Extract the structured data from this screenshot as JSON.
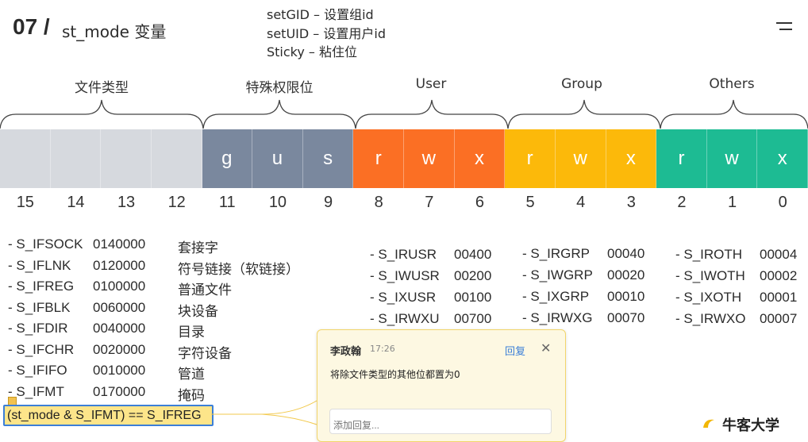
{
  "header": {
    "number": "07 /",
    "title": "st_mode 变量",
    "notes": [
      "setGID – 设置组id",
      "setUID – 设置用户id",
      "Sticky – 粘住位"
    ]
  },
  "groups": [
    {
      "label": "文件类型"
    },
    {
      "label": "特殊权限位"
    },
    {
      "label": "User"
    },
    {
      "label": "Group"
    },
    {
      "label": "Others"
    }
  ],
  "bits": [
    {
      "letter": "",
      "num": "15",
      "color": "#d6d9de"
    },
    {
      "letter": "",
      "num": "14",
      "color": "#d6d9de"
    },
    {
      "letter": "",
      "num": "13",
      "color": "#d6d9de"
    },
    {
      "letter": "",
      "num": "12",
      "color": "#d6d9de"
    },
    {
      "letter": "g",
      "num": "11",
      "color": "#7a889e"
    },
    {
      "letter": "u",
      "num": "10",
      "color": "#7a889e"
    },
    {
      "letter": "s",
      "num": "9",
      "color": "#7a889e"
    },
    {
      "letter": "r",
      "num": "8",
      "color": "#fb6f24"
    },
    {
      "letter": "w",
      "num": "7",
      "color": "#fb6f24"
    },
    {
      "letter": "x",
      "num": "6",
      "color": "#fb6f24"
    },
    {
      "letter": "r",
      "num": "5",
      "color": "#fcb90a"
    },
    {
      "letter": "w",
      "num": "4",
      "color": "#fcb90a"
    },
    {
      "letter": "x",
      "num": "3",
      "color": "#fcb90a"
    },
    {
      "letter": "r",
      "num": "2",
      "color": "#1dbb93"
    },
    {
      "letter": "w",
      "num": "1",
      "color": "#1dbb93"
    },
    {
      "letter": "x",
      "num": "0",
      "color": "#1dbb93"
    }
  ],
  "file_types": [
    {
      "name": "- S_IFSOCK",
      "value": "0140000",
      "desc": "套接字"
    },
    {
      "name": "- S_IFLNK",
      "value": "0120000",
      "desc": "符号链接（软链接）"
    },
    {
      "name": "- S_IFREG",
      "value": "0100000",
      "desc": "普通文件"
    },
    {
      "name": "- S_IFBLK",
      "value": "0060000",
      "desc": "块设备"
    },
    {
      "name": "- S_IFDIR",
      "value": "0040000",
      "desc": "目录"
    },
    {
      "name": "- S_IFCHR",
      "value": "0020000",
      "desc": "字符设备"
    },
    {
      "name": "- S_IFIFO",
      "value": "0010000",
      "desc": "管道"
    },
    {
      "name": "- S_IFMT",
      "value": "0170000",
      "desc": "掩码"
    }
  ],
  "user_perms": [
    {
      "name": "- S_IRUSR",
      "value": "00400"
    },
    {
      "name": "- S_IWUSR",
      "value": "00200"
    },
    {
      "name": "- S_IXUSR",
      "value": "00100"
    },
    {
      "name": "- S_IRWXU",
      "value": "00700"
    }
  ],
  "group_perms": [
    {
      "name": "- S_IRGRP",
      "value": "00040"
    },
    {
      "name": "- S_IWGRP",
      "value": "00020"
    },
    {
      "name": "- S_IXGRP",
      "value": "00010"
    },
    {
      "name": "- S_IRWXG",
      "value": "00070"
    }
  ],
  "other_perms": [
    {
      "name": "- S_IROTH",
      "value": "00004"
    },
    {
      "name": "- S_IWOTH",
      "value": "00002"
    },
    {
      "name": "- S_IXOTH",
      "value": "00001"
    },
    {
      "name": "- S_IRWXO",
      "value": "00007"
    }
  ],
  "formula": "(st_mode & S_IFMT) ==  S_IFREG",
  "comment": {
    "author": "李政翰",
    "time": "17:26",
    "reply_label": "回复",
    "close_icon": "close-icon",
    "text": "将除文件类型的其他位都置为0",
    "input_placeholder": "添加回复..."
  },
  "logo_text": "牛客大学"
}
